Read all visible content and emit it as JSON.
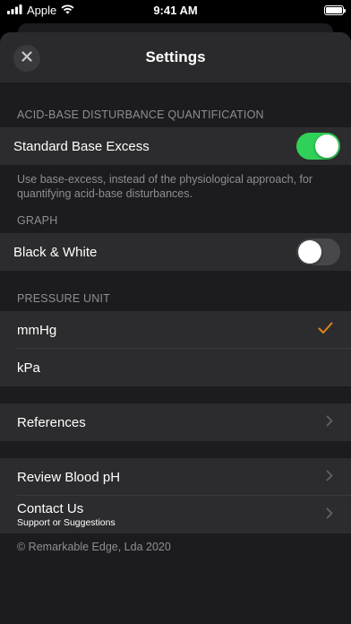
{
  "status_bar": {
    "carrier": "Apple",
    "time": "9:41 AM"
  },
  "nav": {
    "title": "Settings"
  },
  "sections": {
    "acid_base": {
      "header": "ACID-BASE DISTURBANCE QUANTIFICATION",
      "row_label": "Standard Base Excess",
      "toggle_on": true,
      "footer": "Use base-excess, instead of the physiological approach, for quantifying acid-base disturbances."
    },
    "graph": {
      "header": "GRAPH",
      "row_label": "Black & White",
      "toggle_on": false
    },
    "pressure": {
      "header": "PRESSURE UNIT",
      "options": [
        "mmHg",
        "kPa"
      ],
      "selected": "mmHg"
    },
    "references": {
      "label": "References"
    },
    "more": {
      "review_label": "Review Blood pH",
      "contact_label": "Contact Us",
      "contact_subtitle": "Support or Suggestions"
    }
  },
  "copyright": "© Remarkable Edge, Lda 2020",
  "colors": {
    "accent_check": "#e0851e",
    "toggle_on": "#30d158",
    "background": "#1c1c1e",
    "row": "#2c2c2e"
  }
}
